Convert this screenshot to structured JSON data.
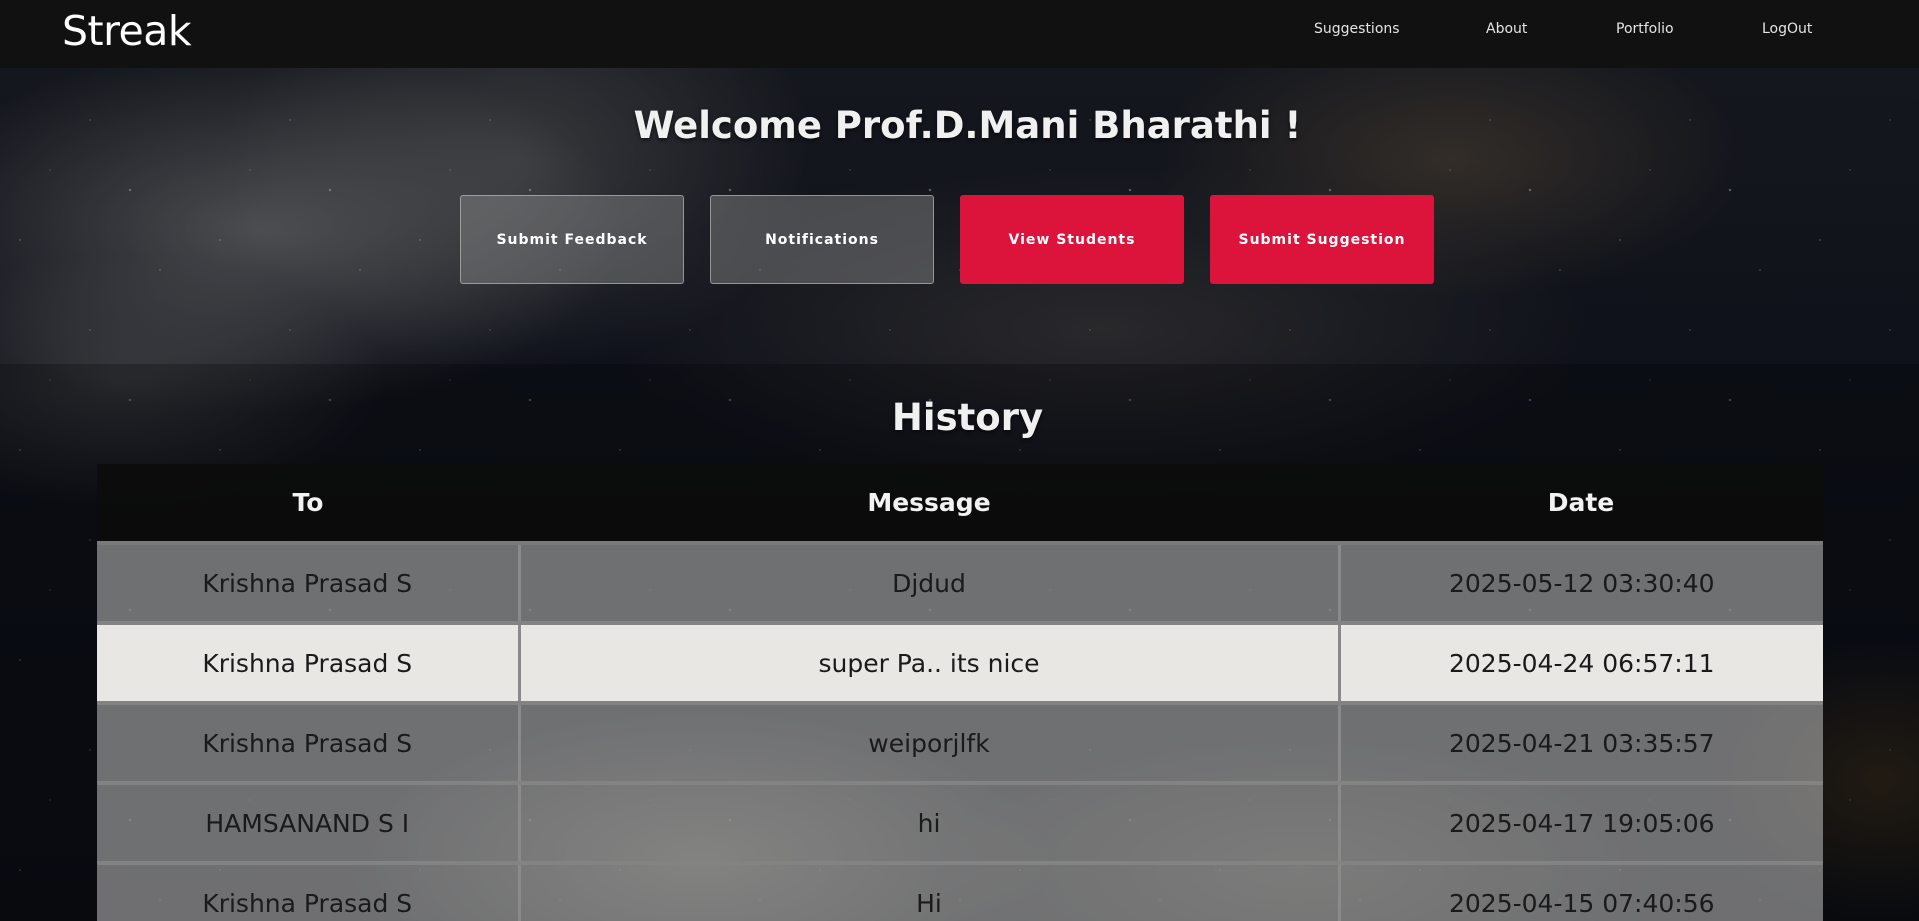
{
  "brand": "Streak",
  "nav": {
    "items": [
      "Suggestions",
      "About",
      "Portfolio",
      "LogOut"
    ]
  },
  "hero": {
    "welcome": "Welcome Prof.D.Mani Bharathi !",
    "buttons": {
      "submit_feedback": "Submit Feedback",
      "notifications": "Notifications",
      "view_students": "View Students",
      "submit_suggestion": "Submit Suggestion"
    }
  },
  "history": {
    "title": "History",
    "columns": [
      "To",
      "Message",
      "Date"
    ],
    "rows": [
      [
        "Krishna Prasad S",
        "Djdud",
        "2025-05-12 03:30:40"
      ],
      [
        "Krishna Prasad S",
        "super Pa.. its nice",
        "2025-04-24 06:57:11"
      ],
      [
        "Krishna Prasad S",
        "weiporjlfk",
        "2025-04-21 03:35:57"
      ],
      [
        "HAMSANAND S I",
        "hi",
        "2025-04-17 19:05:06"
      ],
      [
        "Krishna Prasad S",
        "Hi",
        "2025-04-15 07:40:56"
      ]
    ]
  },
  "colors": {
    "accent": "#dc143c",
    "navbar": "#111111",
    "highlight_row": "#e8e7e4"
  }
}
